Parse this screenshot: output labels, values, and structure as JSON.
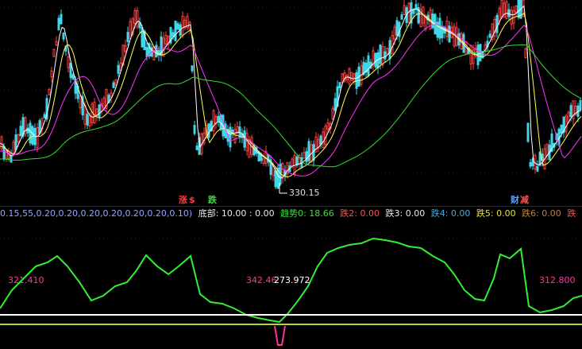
{
  "chart_data": [
    {
      "type": "line",
      "title": "",
      "annotations": {
        "low_price": "330.15"
      },
      "signals": [
        {
          "text": "涨",
          "color": "#ff3b3b"
        },
        {
          "text": "$",
          "color": "#ff3b3b"
        },
        {
          "text": "跌",
          "color": "#3be03b"
        },
        {
          "text": "财",
          "color": "#55a0ff"
        },
        {
          "text": "减",
          "color": "#ff4f4f"
        }
      ],
      "series": [
        {
          "color": "#ffffff"
        },
        {
          "color": "#ffff55"
        },
        {
          "color": "#ff33ff"
        },
        {
          "color": "#33dd33"
        }
      ]
    },
    {
      "type": "line",
      "info_prefix": "0.15,55,0.20,0.20,0.20,0.20,0.20,0.20,0.10)",
      "fields": [
        {
          "label": "底部: 10.00 : 0.00",
          "color": "#e8e8e8"
        },
        {
          "label": "趋势0: 18.66",
          "color": "#3be03b"
        },
        {
          "label": "跌2: 0.00",
          "color": "#ff4f4f"
        },
        {
          "label": "跌3: 0.00",
          "color": "#e8e8e8"
        },
        {
          "label": "跌4: 0.00",
          "color": "#4aa8d8"
        },
        {
          "label": "跌5: 0.00",
          "color": "#e0e040"
        },
        {
          "label": "跌6: 0.00",
          "color": "#c08040"
        },
        {
          "label": "跌",
          "color": "#ff4f4f"
        }
      ],
      "value_labels": [
        "321.410",
        "342.46",
        "273.972",
        "312.800"
      ],
      "curve_color": "#33ee33",
      "baseline_colors": [
        "#ffffff",
        "#aadd22"
      ],
      "signal_color": "#ff3399"
    }
  ]
}
